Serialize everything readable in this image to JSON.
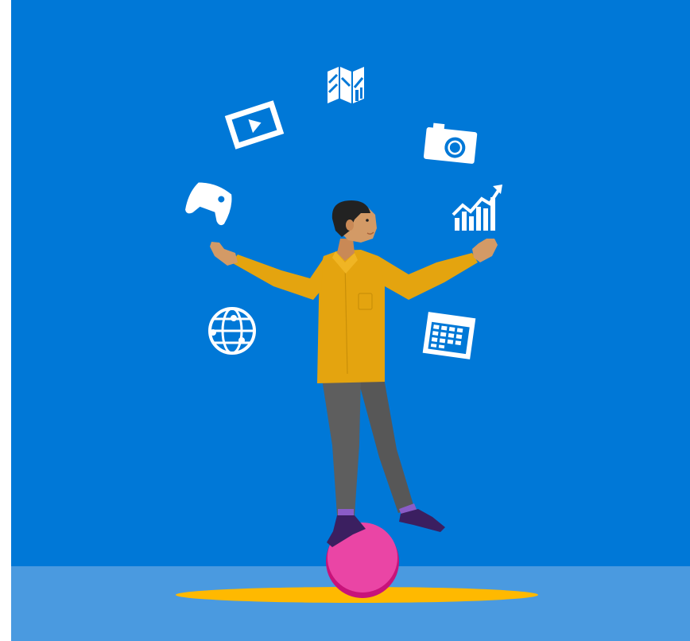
{
  "scene": {
    "description_colors": {
      "sky": "#0078d7",
      "floor": "#4b9ae1",
      "shadow": "#ffb900",
      "ball": "#e83c9c",
      "ball_shade": "#c8157a",
      "shirt": "#e6a30a",
      "pants": "#5a5a5a",
      "skin": "#d39a66",
      "hair": "#222222",
      "shoes": "#3a1f5e",
      "icons": "#ffffff"
    },
    "icons": [
      "map-icon",
      "video-icon",
      "camera-icon",
      "gamepad-icon",
      "stocks-icon",
      "globe-icon",
      "calendar-icon"
    ]
  }
}
